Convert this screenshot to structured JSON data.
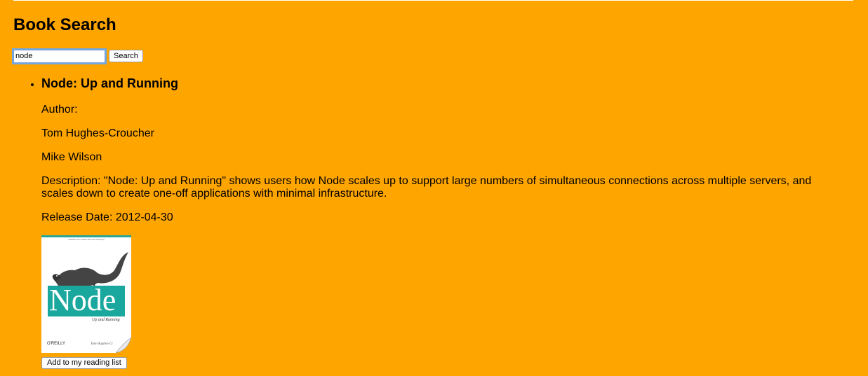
{
  "page": {
    "title": "Book Search"
  },
  "search": {
    "value": "node",
    "button_label": "Search"
  },
  "results": [
    {
      "title": "Node: Up and Running",
      "author_label": "Author:",
      "authors": [
        "Tom Hughes-Croucher",
        "Mike Wilson"
      ],
      "description": "Description: \"Node: Up and Running\" shows users how Node scales up to support large numbers of simultaneous connections across multiple servers, and scales down to create one-off applications with minimal infrastructure.",
      "release_date": "Release Date: 2012-04-30",
      "cover": {
        "tagline": "Scalable Server-Side Code with JavaScript",
        "title": "Node",
        "subtitle": "Up and Running",
        "publisher": "O'REILLY",
        "author": "Tom Hughes-Cr"
      },
      "add_button_label": "Add to my reading list"
    }
  ],
  "colors": {
    "background": "#ffa500",
    "cover_accent": "#1aa89e"
  }
}
